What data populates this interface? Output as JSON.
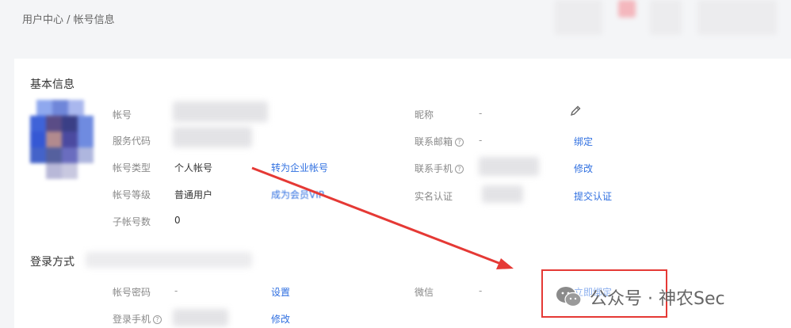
{
  "breadcrumb": "用户中心 / 帐号信息",
  "basic_info": {
    "title": "基本信息",
    "left_rows": [
      {
        "label": "帐号",
        "value": "",
        "action": ""
      },
      {
        "label": "服务代码",
        "value": "",
        "action": ""
      },
      {
        "label": "帐号类型",
        "value": "个人帐号",
        "action": "转为企业帐号"
      },
      {
        "label": "帐号等级",
        "value": "普通用户",
        "action": "成为会员VIP"
      },
      {
        "label": "子帐号数",
        "value": "0",
        "action": ""
      }
    ],
    "right_rows": [
      {
        "label": "昵称",
        "value": "-",
        "action": ""
      },
      {
        "label": "联系邮箱",
        "value": "-",
        "action": "绑定"
      },
      {
        "label": "联系手机",
        "value": "",
        "action": "修改"
      },
      {
        "label": "实名认证",
        "value": "",
        "action": "提交认证"
      }
    ]
  },
  "login_methods": {
    "title": "登录方式",
    "left_rows": [
      {
        "label": "帐号密码",
        "value": "-",
        "action": "设置"
      },
      {
        "label": "登录手机",
        "value": "",
        "action": "修改"
      }
    ],
    "right_rows": [
      {
        "label": "微信",
        "value": "-",
        "action": "立即绑定"
      }
    ]
  },
  "watermark": {
    "text": "公众号 · 神农Sec",
    "icon": "wechat-icon"
  },
  "colors": {
    "link": "#2f6fe0",
    "annotation": "#e53935"
  }
}
